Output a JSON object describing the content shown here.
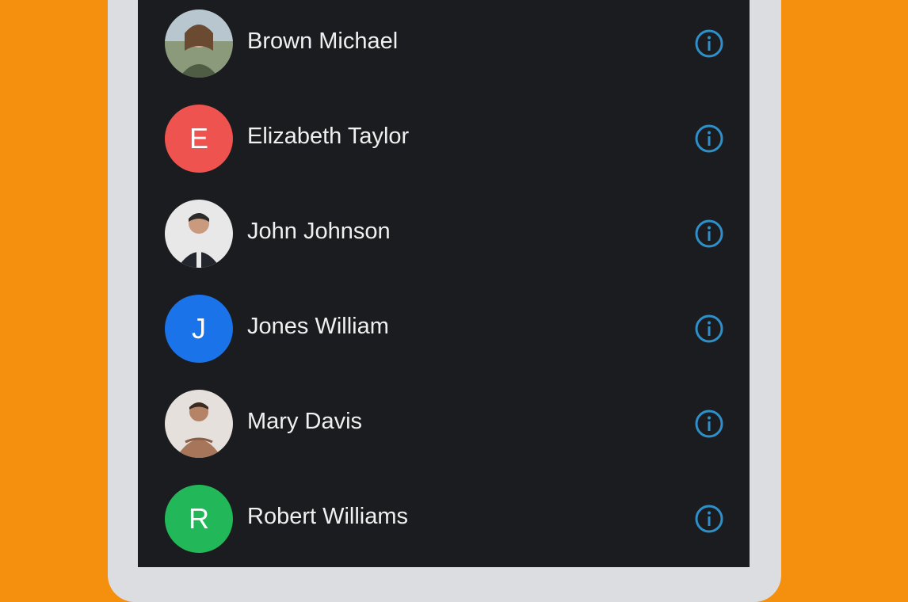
{
  "colors": {
    "background": "#f5900e",
    "screen": "#1b1c1f",
    "info_icon": "#2f8fc9"
  },
  "contacts": [
    {
      "name": "Brown Michael",
      "avatar_type": "photo",
      "avatar_icon": "person-photo-icon",
      "info_icon": "info-icon"
    },
    {
      "name": "Elizabeth Taylor",
      "avatar_type": "letter",
      "avatar_letter": "E",
      "avatar_color": "#ef5350",
      "info_icon": "info-icon"
    },
    {
      "name": "John Johnson",
      "avatar_type": "photo",
      "avatar_icon": "person-photo-icon",
      "info_icon": "info-icon"
    },
    {
      "name": "Jones William",
      "avatar_type": "letter",
      "avatar_letter": "J",
      "avatar_color": "#1a73e8",
      "info_icon": "info-icon"
    },
    {
      "name": "Mary Davis",
      "avatar_type": "photo",
      "avatar_icon": "person-photo-icon",
      "info_icon": "info-icon"
    },
    {
      "name": "Robert Williams",
      "avatar_type": "letter",
      "avatar_letter": "R",
      "avatar_color": "#22b85a",
      "info_icon": "info-icon"
    }
  ]
}
